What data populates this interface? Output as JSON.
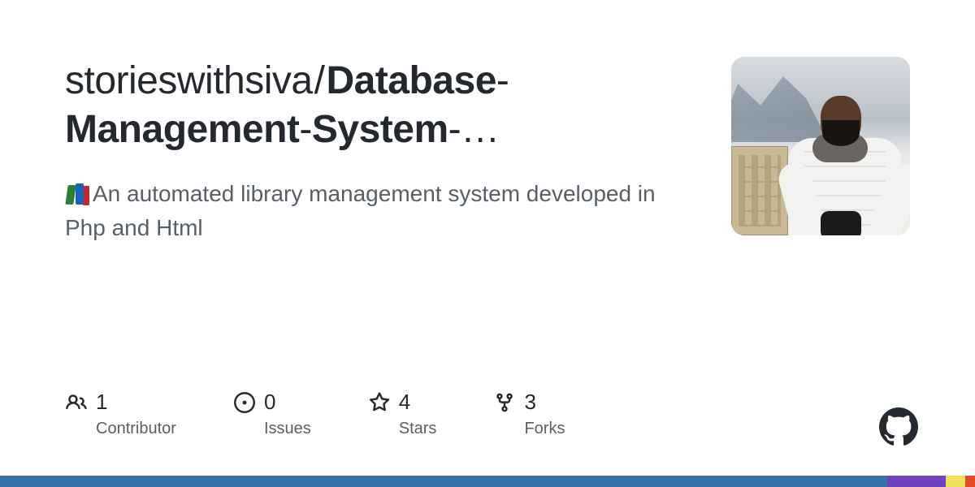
{
  "repo": {
    "owner": "storieswithsiva",
    "name_line1": "Database",
    "name_line2": "Management",
    "name_line3": "System",
    "name_ellipsis": "…"
  },
  "description": "An automated library management system developed in Php and Html",
  "stats": {
    "contributors": {
      "count": "1",
      "label": "Contributor"
    },
    "issues": {
      "count": "0",
      "label": "Issues"
    },
    "stars": {
      "count": "4",
      "label": "Stars"
    },
    "forks": {
      "count": "3",
      "label": "Forks"
    }
  },
  "language_bar": [
    {
      "color": "#3572A5",
      "pct": 91
    },
    {
      "color": "#6f42c1",
      "pct": 6
    },
    {
      "color": "#f1e05a",
      "pct": 2
    },
    {
      "color": "#e34c26",
      "pct": 1
    }
  ]
}
